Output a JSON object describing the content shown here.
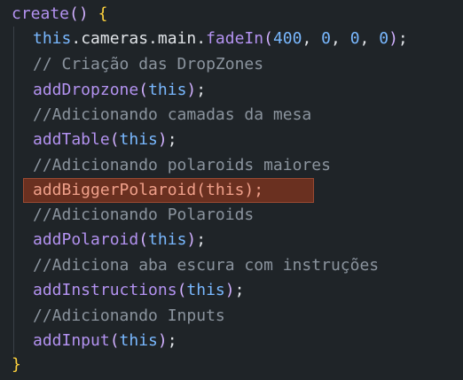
{
  "colors": {
    "background": "#1f2428",
    "function": "#b392f0",
    "keyword": "#79b8ff",
    "comment": "#8b949e",
    "highlight": "#6a3020"
  },
  "code": {
    "l1_fn": "create",
    "l1_parens": "()",
    "l1_brace": "{",
    "l2_this": "this",
    "l2_chain": ".cameras.main.",
    "l2_fn": "fadeIn",
    "l2_open": "(",
    "l2_n1": "400",
    "l2_sep1": ", ",
    "l2_n2": "0",
    "l2_sep2": ", ",
    "l2_n3": "0",
    "l2_sep3": ", ",
    "l2_n4": "0",
    "l2_close": ")",
    "l2_semi": ";",
    "l3_comment": "// Criação das DropZones",
    "l4_fn": "addDropzone",
    "l4_arg": "this",
    "l5_comment": "//Adicionando camadas da mesa",
    "l6_fn": "addTable",
    "l6_arg": "this",
    "l7_comment": "//Adicionando polaroids maiores",
    "l8_text": "addBiggerPolaroid(this);",
    "l9_comment": "//Adicionando Polaroids",
    "l10_fn": "addPolaroid",
    "l10_arg": "this",
    "l11_comment": "//Adiciona aba escura com instruções",
    "l12_fn": "addInstructions",
    "l12_arg": "this",
    "l13_comment": "//Adicionando Inputs",
    "l14_fn": "addInput",
    "l14_arg": "this",
    "l15_brace": "}",
    "open_paren": "(",
    "close_paren": ")",
    "semi": ";"
  }
}
